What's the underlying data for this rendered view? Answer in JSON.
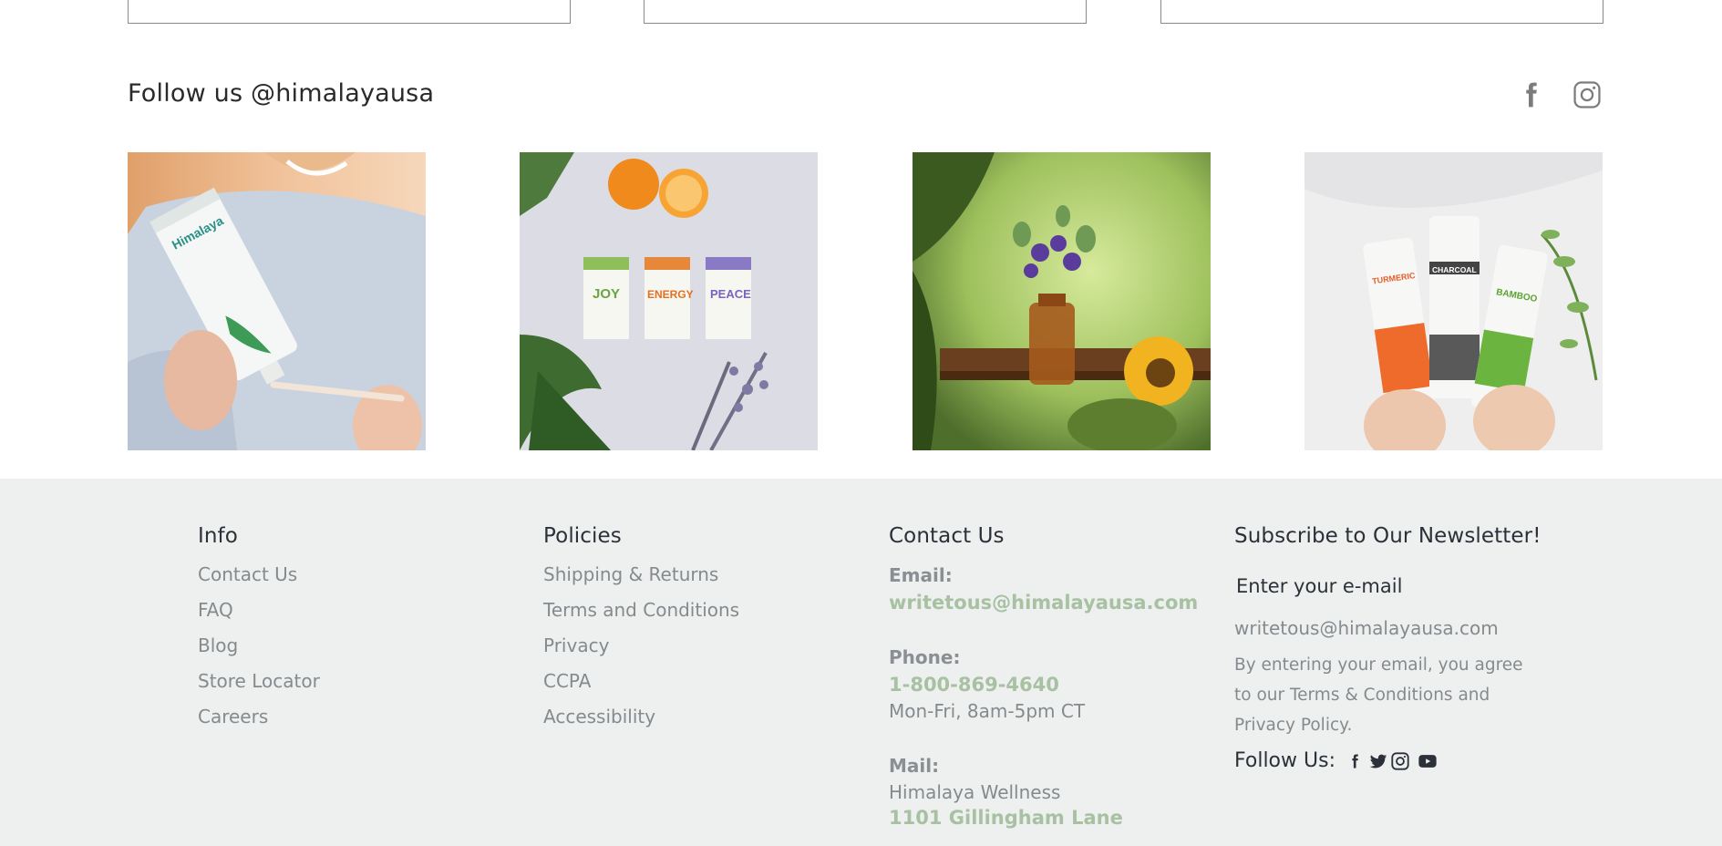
{
  "social_section": {
    "heading": "Follow us @himalayausa",
    "icons": [
      "facebook-icon",
      "instagram-icon"
    ]
  },
  "photos": [
    {
      "name": "toothpaste-photo"
    },
    {
      "name": "tea-boxes-photo"
    },
    {
      "name": "flower-vase-photo"
    },
    {
      "name": "toothpaste-trio-photo"
    }
  ],
  "footer": {
    "info": {
      "title": "Info",
      "links": [
        "Contact Us",
        "FAQ",
        "Blog",
        "Store Locator",
        "Careers"
      ]
    },
    "policies": {
      "title": "Policies",
      "links": [
        "Shipping & Returns",
        "Terms and Conditions",
        "Privacy",
        "CCPA",
        "Accessibility"
      ]
    },
    "contact": {
      "title": "Contact Us",
      "email_label": "Email:",
      "email_value": "writetous@himalayausa.com",
      "phone_label": "Phone:",
      "phone_value": "1-800-869-4640",
      "hours": "Mon-Fri, 8am-5pm CT",
      "mail_label": "Mail:",
      "mail_name": "Himalaya Wellness",
      "mail_street": "1101 Gillingham Lane"
    },
    "newsletter": {
      "title": "Subscribe to Our Newsletter!",
      "email_label": "Enter your e-mail",
      "email_input_value": "writetous@himalayausa.com",
      "legal": "By entering your email, you agree to our Terms & Conditions and Privacy Policy.",
      "follow_label": "Follow Us:",
      "icons": [
        "facebook-icon",
        "twitter-icon",
        "instagram-icon",
        "youtube-icon"
      ]
    }
  },
  "colors": {
    "footer_bg": "#edf0ef",
    "accent_green": "#a8c1a3",
    "muted_text": "#858a8e"
  }
}
